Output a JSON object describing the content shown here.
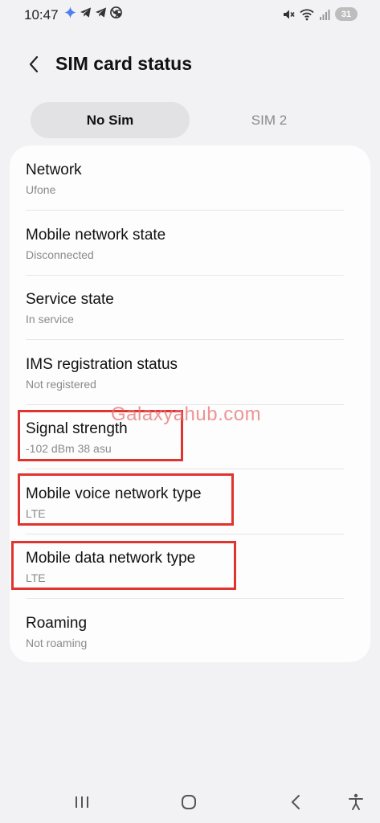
{
  "status_bar": {
    "time": "10:47",
    "battery": "31",
    "left_icons": [
      "gemini-sparkle-icon",
      "telegram-icon",
      "telegram-icon",
      "chrome-icon"
    ],
    "right_icons": [
      "mute-icon",
      "wifi-icon",
      "signal-icon",
      "battery-icon"
    ]
  },
  "header": {
    "title": "SIM card status"
  },
  "tabs": [
    {
      "label": "No Sim",
      "active": true
    },
    {
      "label": "SIM 2",
      "active": false
    }
  ],
  "items": [
    {
      "title": "Network",
      "value": "Ufone"
    },
    {
      "title": "Mobile network state",
      "value": "Disconnected"
    },
    {
      "title": "Service state",
      "value": "In service"
    },
    {
      "title": "IMS registration status",
      "value": "Not registered"
    },
    {
      "title": "Signal strength",
      "value": "-102 dBm 38 asu"
    },
    {
      "title": "Mobile voice network type",
      "value": "LTE"
    },
    {
      "title": "Mobile data network type",
      "value": "LTE"
    },
    {
      "title": "Roaming",
      "value": "Not roaming"
    }
  ],
  "watermark": "Galaxyahub.com",
  "colors": {
    "background": "#f2f2f4",
    "card": "#fdfdfe",
    "highlight": "#e0342f",
    "active_tab": "#e2e2e5",
    "secondary_text": "#8a8a8a"
  },
  "nav_bar": [
    "recent-apps-icon",
    "home-icon",
    "back-icon",
    "accessibility-icon"
  ]
}
